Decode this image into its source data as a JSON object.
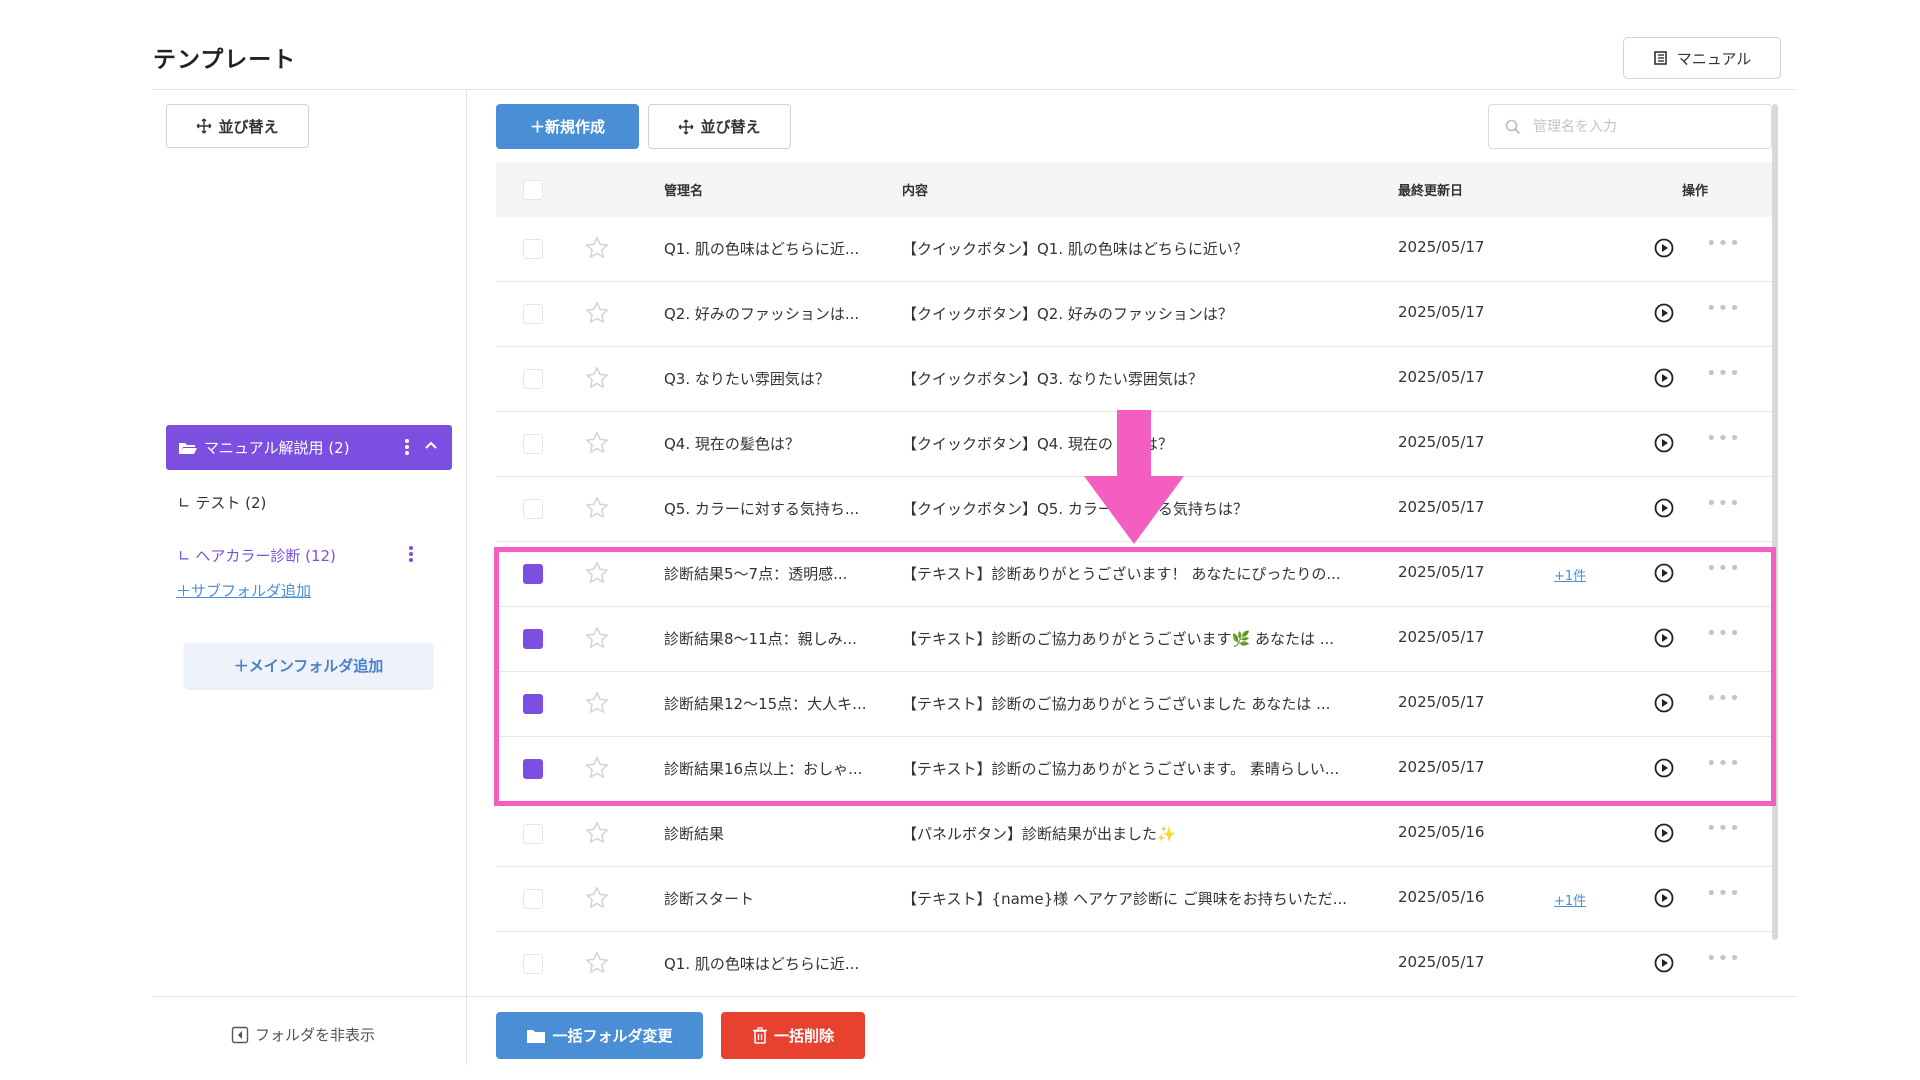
{
  "page": {
    "title": "テンプレート",
    "manual_label": "マニュアル"
  },
  "sidebar": {
    "sort_label": "並び替え",
    "folders": [
      {
        "label": "マニュアル解説用 (2)",
        "active": true
      },
      {
        "label": "∟ テスト (2)"
      },
      {
        "label": "∟ ヘアカラー診断 (12)"
      }
    ],
    "add_subfolder": "＋サブフォルダ追加",
    "add_mainfolder": "＋メインフォルダ追加",
    "hide_folder": "フォルダを非表示"
  },
  "toolbar": {
    "new_label": "＋新規作成",
    "sort_label": "並び替え",
    "search_placeholder": "管理名を入力"
  },
  "table": {
    "headers": {
      "name": "管理名",
      "content": "内容",
      "updated": "最終更新日",
      "actions": "操作"
    },
    "rows": [
      {
        "name": "Q1. 肌の色味はどちらに近...",
        "content": "【クイックボタン】Q1. 肌の色味はどちらに近い？",
        "date": "2025/05/17",
        "extra": "",
        "checked": false
      },
      {
        "name": "Q2. 好みのファッションは...",
        "content": "【クイックボタン】Q2. 好みのファッションは？",
        "date": "2025/05/17",
        "extra": "",
        "checked": false
      },
      {
        "name": "Q3. なりたい雰囲気は？",
        "content": "【クイックボタン】Q3. なりたい雰囲気は？",
        "date": "2025/05/17",
        "extra": "",
        "checked": false
      },
      {
        "name": "Q4. 現在の髪色は？",
        "content": "【クイックボタン】Q4. 現在の　　は？",
        "date": "2025/05/17",
        "extra": "",
        "checked": false
      },
      {
        "name": "Q5. カラーに対する気持ち...",
        "content": "【クイックボタン】Q5. カラー　　する気持ちは？",
        "date": "2025/05/17",
        "extra": "",
        "checked": false
      },
      {
        "name": "診断結果5〜7点：透明感...",
        "content": "【テキスト】診断ありがとうございます！ あなたにぴったりの...",
        "date": "2025/05/17",
        "extra": "+1件",
        "checked": true
      },
      {
        "name": "診断結果8〜11点：親しみ...",
        "content": "【テキスト】診断のご協力ありがとうございます🌿 あなたは ...",
        "date": "2025/05/17",
        "extra": "",
        "checked": true
      },
      {
        "name": "診断結果12〜15点：大人キ...",
        "content": "【テキスト】診断のご協力ありがとうございました あなたは ...",
        "date": "2025/05/17",
        "extra": "",
        "checked": true
      },
      {
        "name": "診断結果16点以上：おしゃ...",
        "content": "【テキスト】診断のご協力ありがとうございます。 素晴らしい...",
        "date": "2025/05/17",
        "extra": "",
        "checked": true
      },
      {
        "name": "診断結果",
        "content": "【パネルボタン】診断結果が出ました✨",
        "date": "2025/05/16",
        "extra": "",
        "checked": false
      },
      {
        "name": "診断スタート",
        "content": "【テキスト】{name}様 ヘアケア診断に ご興味をお持ちいただ...",
        "date": "2025/05/16",
        "extra": "+1件",
        "checked": false
      },
      {
        "name": "Q1. 肌の色味はどちらに近...",
        "content": "",
        "date": "2025/05/17",
        "extra": "",
        "checked": false
      }
    ]
  },
  "footer": {
    "bulk_folder_change": "一括フォルダ変更",
    "bulk_delete": "一括削除"
  },
  "colors": {
    "accent_purple": "#7b4fe0",
    "primary_blue": "#4a8fd6",
    "danger_red": "#e8412f",
    "highlight_pink": "#f55ec1"
  },
  "icons": [
    "book-icon",
    "move-icon",
    "search-icon",
    "folder-open-icon",
    "kebab-icon",
    "chevron-up-icon",
    "star-icon",
    "play-circle-icon",
    "more-icon",
    "collapse-icon",
    "folder-icon",
    "trash-icon",
    "arrow-down-icon"
  ]
}
